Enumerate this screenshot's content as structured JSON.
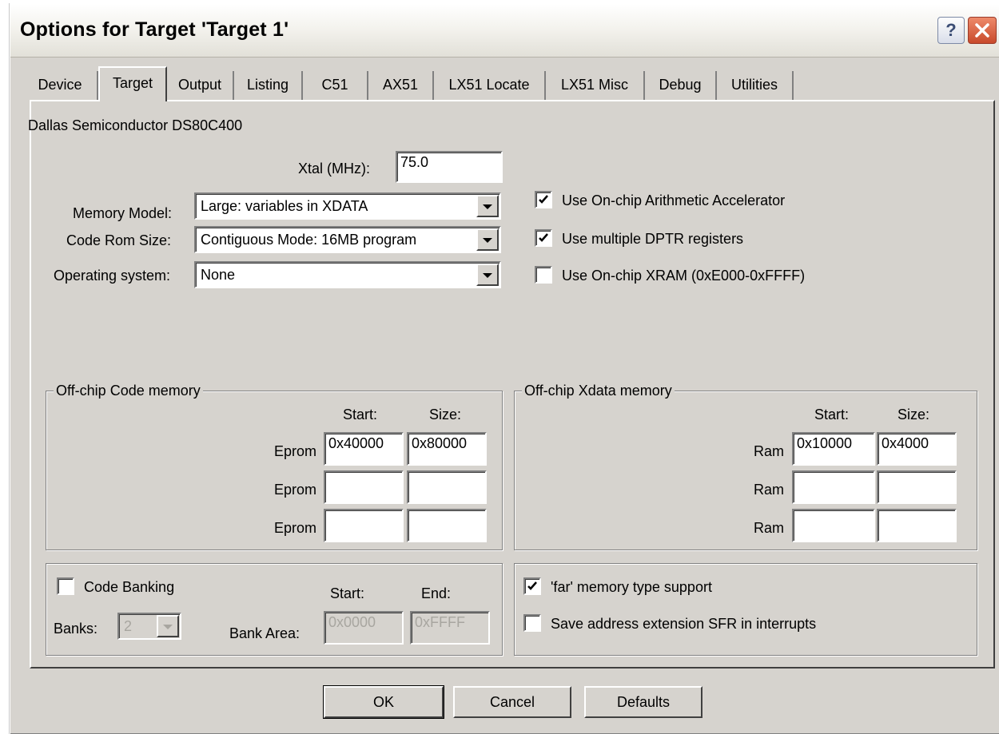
{
  "window": {
    "title": "Options for Target 'Target 1'"
  },
  "tabs": [
    {
      "label": "Device"
    },
    {
      "label": "Target"
    },
    {
      "label": "Output"
    },
    {
      "label": "Listing"
    },
    {
      "label": "C51"
    },
    {
      "label": "AX51"
    },
    {
      "label": "LX51 Locate"
    },
    {
      "label": "LX51 Misc"
    },
    {
      "label": "Debug"
    },
    {
      "label": "Utilities"
    }
  ],
  "active_tab": "Target",
  "device_name": "Dallas Semiconductor DS80C400",
  "xtal": {
    "label": "Xtal (MHz):",
    "value": "75.0"
  },
  "memory_model": {
    "label": "Memory Model:",
    "value": "Large: variables in XDATA"
  },
  "code_rom_size": {
    "label": "Code Rom Size:",
    "value": "Contiguous Mode: 16MB program"
  },
  "operating_system": {
    "label": "Operating system:",
    "value": "None"
  },
  "options": {
    "arith_accel": {
      "label": "Use On-chip Arithmetic Accelerator",
      "checked": true
    },
    "multi_dptr": {
      "label": "Use multiple DPTR registers",
      "checked": true
    },
    "onchip_xram": {
      "label": "Use On-chip XRAM (0xE000-0xFFFF)",
      "checked": false
    }
  },
  "code_memory": {
    "title": "Off-chip Code memory",
    "start_header": "Start:",
    "size_header": "Size:",
    "rows": [
      {
        "label": "Eprom",
        "start": "0x40000",
        "size": "0x80000"
      },
      {
        "label": "Eprom",
        "start": "",
        "size": ""
      },
      {
        "label": "Eprom",
        "start": "",
        "size": ""
      }
    ]
  },
  "xdata_memory": {
    "title": "Off-chip Xdata memory",
    "start_header": "Start:",
    "size_header": "Size:",
    "rows": [
      {
        "label": "Ram",
        "start": "0x10000",
        "size": "0x4000"
      },
      {
        "label": "Ram",
        "start": "",
        "size": ""
      },
      {
        "label": "Ram",
        "start": "",
        "size": ""
      }
    ]
  },
  "banking": {
    "label": "Code Banking",
    "checked": false,
    "banks_label": "Banks:",
    "banks_value": "2",
    "start_header": "Start:",
    "end_header": "End:",
    "bank_area_label": "Bank Area:",
    "start": "0x0000",
    "end": "0xFFFF"
  },
  "far_options": {
    "far_support": {
      "label": "'far' memory type support",
      "checked": true
    },
    "save_sfr": {
      "label": "Save address extension SFR in interrupts",
      "checked": false
    }
  },
  "buttons": {
    "ok": "OK",
    "cancel": "Cancel",
    "defaults": "Defaults"
  }
}
